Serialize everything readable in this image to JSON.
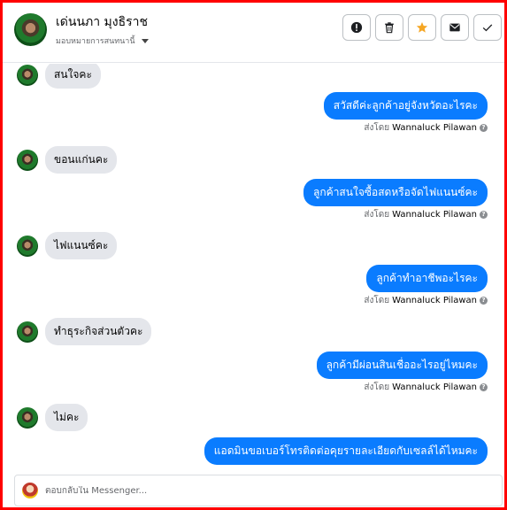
{
  "header": {
    "name": "เด่นนภา มุงธิราช",
    "assignee": "มอบหมายการสนทนานี้",
    "actions": [
      {
        "icon": "alert-icon",
        "label": "mark-spam"
      },
      {
        "icon": "trash-icon",
        "label": "delete"
      },
      {
        "icon": "star-icon",
        "label": "follow-up",
        "color": "#f5a623"
      },
      {
        "icon": "envelope-icon",
        "label": "mark-unread"
      },
      {
        "icon": "check-icon",
        "label": "mark-done"
      }
    ]
  },
  "messages": [
    {
      "dir": "in",
      "text": "สนใจคะ"
    },
    {
      "dir": "out",
      "text": "สวัสดีค่ะลูกค้าอยู่จังหวัดอะไรคะ",
      "sent_by_label": "ส่งโดย",
      "sender": "Wannaluck Pilawan"
    },
    {
      "dir": "in",
      "text": "ขอนแก่นคะ"
    },
    {
      "dir": "out",
      "text": "ลูกค้าสนใจซื้อสดหรือจัดไฟแนนซ์คะ",
      "sent_by_label": "ส่งโดย",
      "sender": "Wannaluck Pilawan"
    },
    {
      "dir": "in",
      "text": "ไฟแนนซ์คะ"
    },
    {
      "dir": "out",
      "text": "ลูกค้าทำอาชีพอะไรคะ",
      "sent_by_label": "ส่งโดย",
      "sender": "Wannaluck Pilawan"
    },
    {
      "dir": "in",
      "text": "ทำธุระกิจส่วนตัวคะ"
    },
    {
      "dir": "out",
      "text": "ลูกค้ามีผ่อนสินเชื่ออะไรอยู่ไหมคะ",
      "sent_by_label": "ส่งโดย",
      "sender": "Wannaluck Pilawan"
    },
    {
      "dir": "in",
      "text": "ไม่คะ"
    },
    {
      "dir": "out",
      "text": "แอดมินขอเบอร์โทรติดต่อคุยรายละเอียดกับเซลล์ได้ไหมคะ"
    }
  ],
  "reply": {
    "placeholder": "ตอบกลับใน Messenger..."
  },
  "colors": {
    "outgoing_bubble": "#0a7cff",
    "incoming_bubble": "#e4e6eb",
    "frame": "#ff0000"
  }
}
